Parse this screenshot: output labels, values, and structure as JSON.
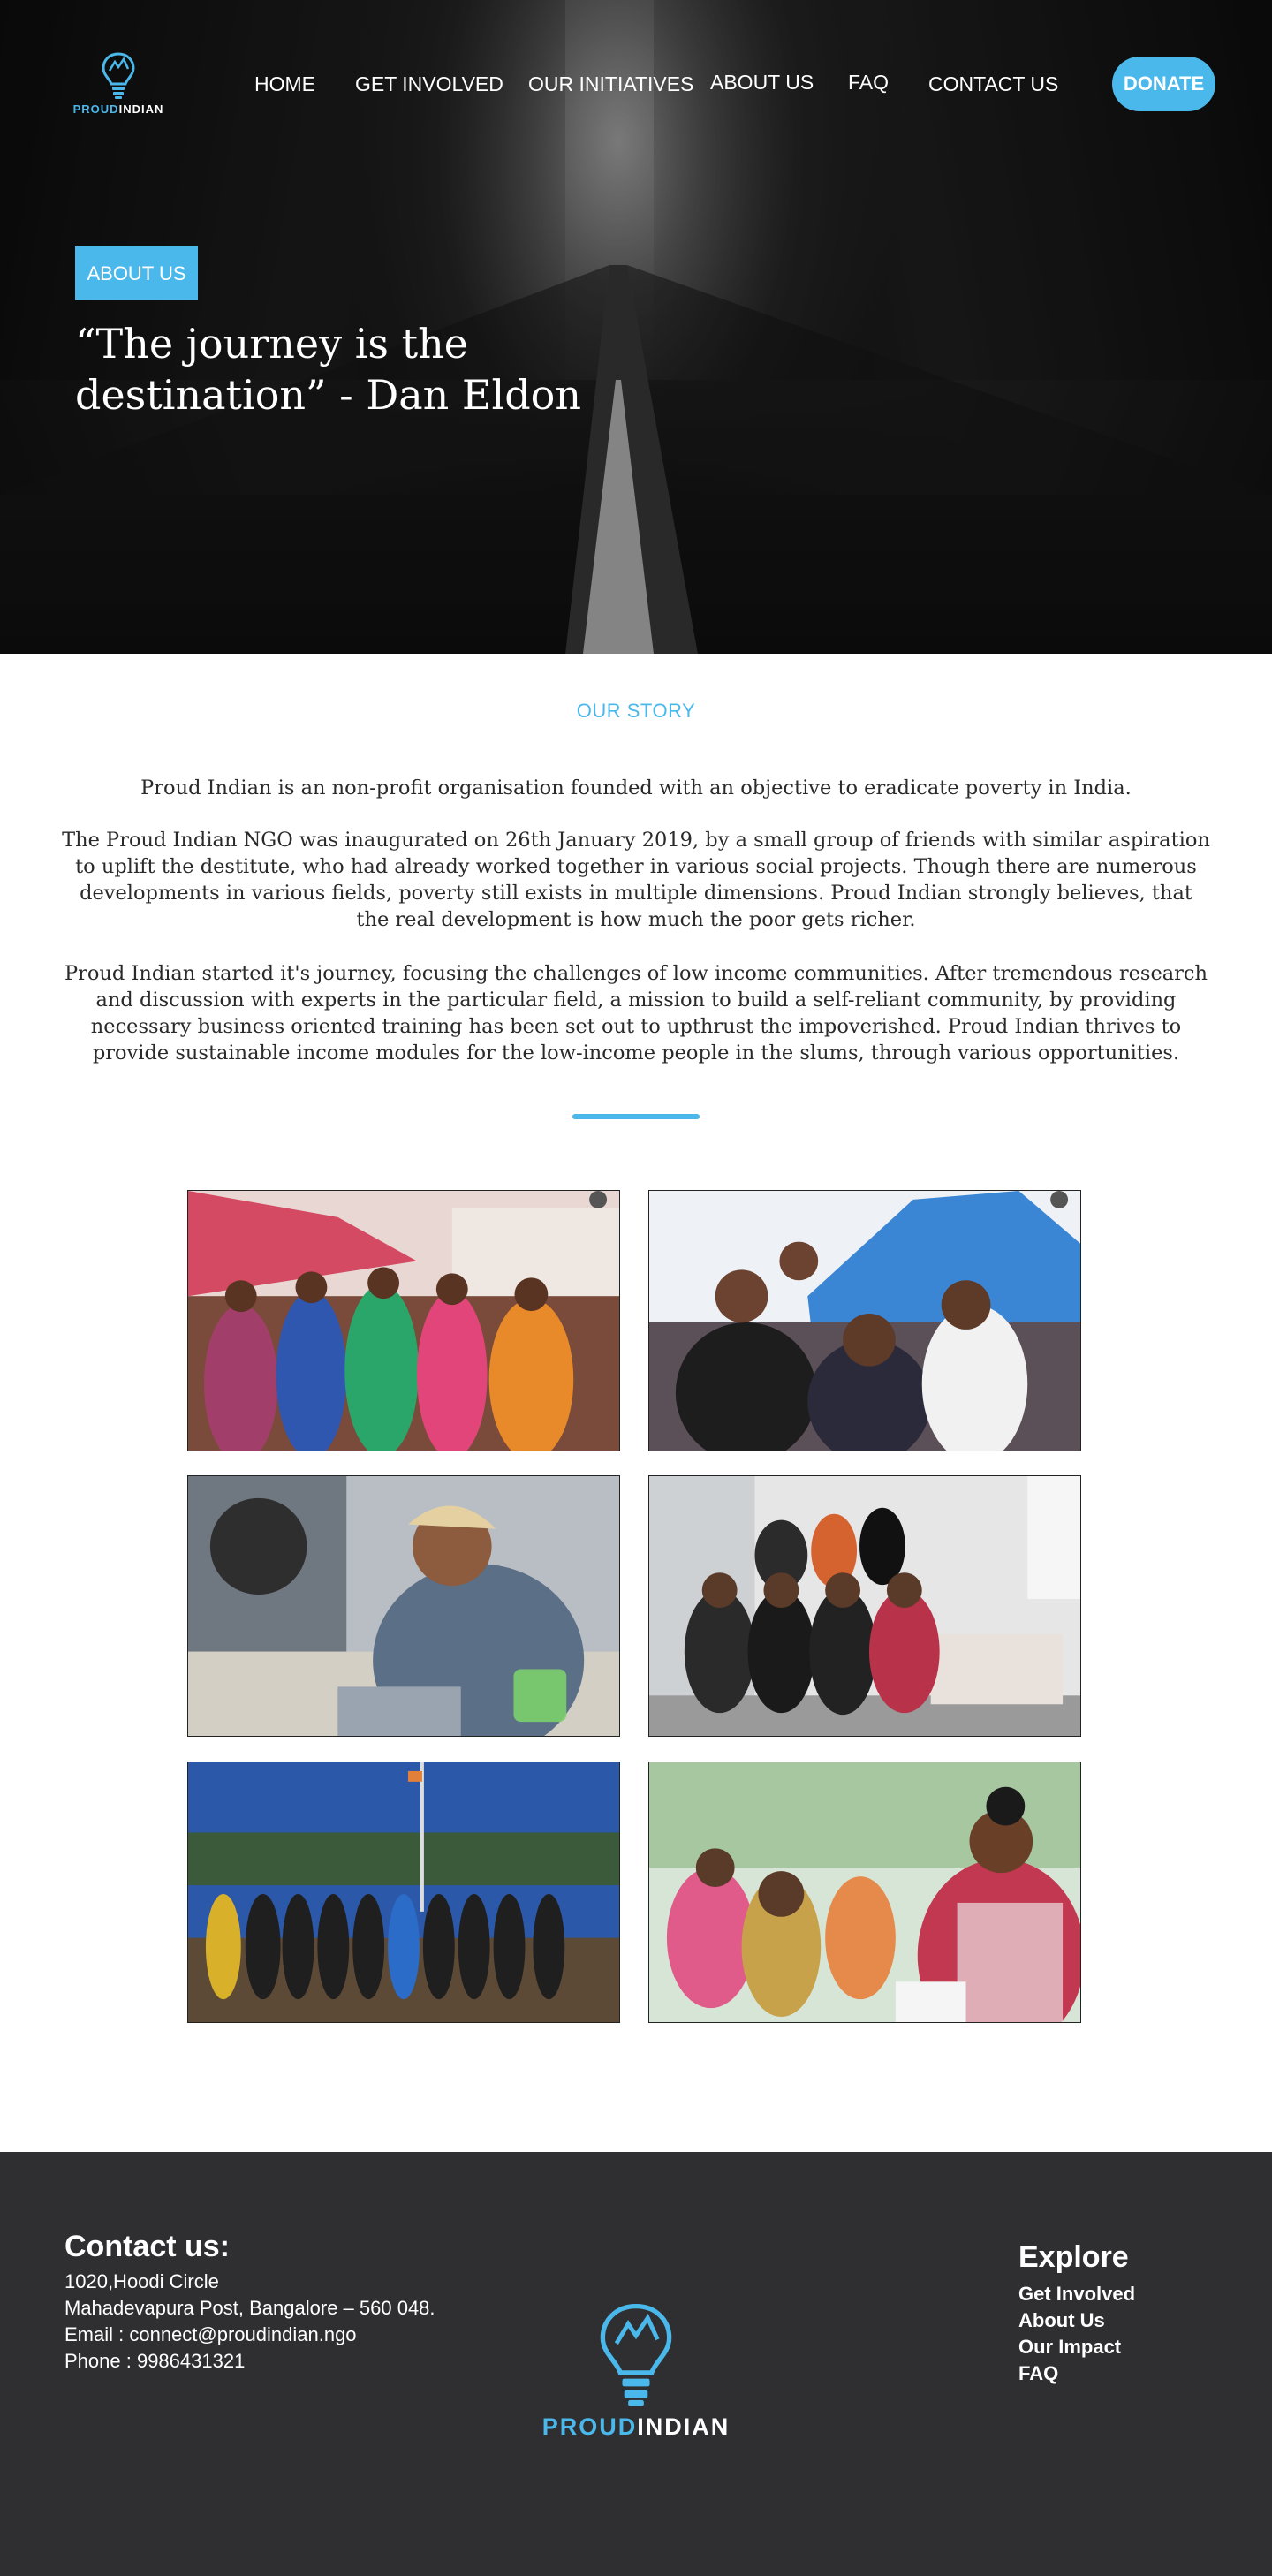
{
  "brand": {
    "name_part1": "PROUD",
    "name_part2": "INDIAN",
    "accent_color": "#4ab8ea",
    "logo_icon": "lightbulb-icon"
  },
  "nav": {
    "items": [
      "HOME",
      "GET INVOLVED",
      "OUR INITIATIVES",
      "ABOUT US",
      "FAQ",
      "CONTACT US"
    ],
    "donate_label": "DONATE"
  },
  "hero": {
    "badge": "ABOUT US",
    "quote": "“The journey is the destination” - Dan Eldon"
  },
  "story": {
    "label": "OUR STORY",
    "paragraphs": [
      "Proud Indian is an non-profit organisation founded with an objective to eradicate poverty in India.",
      "The Proud Indian NGO was inaugurated on 26th January 2019, by a small group of friends with similar aspiration to uplift the destitute, who had already worked together in various social projects. Though there are numerous developments in various fields, poverty still exists in multiple dimensions. Proud Indian strongly believes, that the real development is how much the poor gets richer.",
      "Proud Indian started it's journey, focusing the challenges of low income communities. After tremendous research and discussion with experts in the particular field, a mission to build a self-reliant community, by providing necessary business oriented training has been set out to upthrust the impoverished. Proud Indian thrives to provide sustainable income modules for the low-income people in the slums, through various opportunities."
    ]
  },
  "gallery": {
    "photos": [
      {
        "icon": "photo-women-celebrating"
      },
      {
        "icon": "photo-children-smiling"
      },
      {
        "icon": "photo-man-crafting"
      },
      {
        "icon": "photo-team-group"
      },
      {
        "icon": "photo-outdoor-group-flag"
      },
      {
        "icon": "photo-health-camp"
      }
    ]
  },
  "footer": {
    "contact_title": "Contact us:",
    "address_line1": "1020,Hoodi Circle",
    "address_line2": "Mahadevapura Post, Bangalore – 560 048.",
    "email": "Email : connect@proudindian.ngo",
    "phone": "Phone : 9986431321",
    "explore_title": "Explore",
    "explore_links": [
      "Get Involved",
      "About Us",
      "Our Impact",
      "FAQ"
    ]
  }
}
